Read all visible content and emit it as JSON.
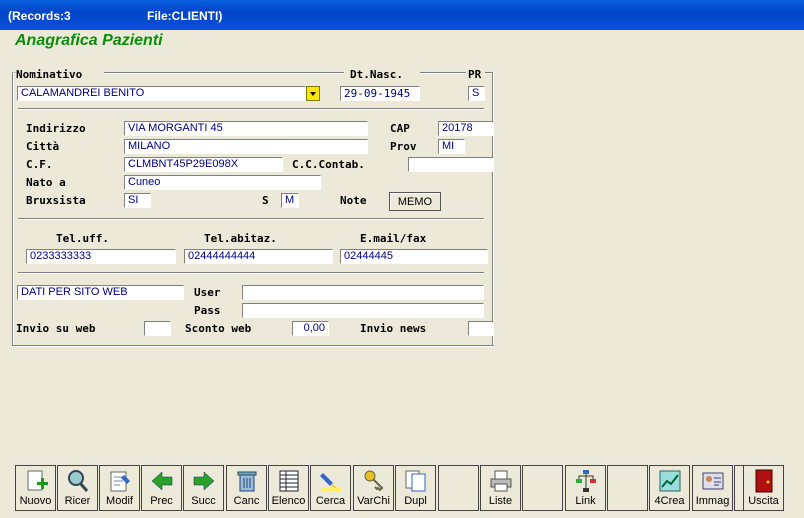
{
  "titlebar": {
    "records": "(Records:3",
    "file": "File:CLIENTI)"
  },
  "heading": "Anagrafica Pazienti",
  "labels": {
    "nominativo": "Nominativo",
    "dtnasc": "Dt.Nasc.",
    "pr": "PR",
    "indirizzo": "Indirizzo",
    "cap": "CAP",
    "citta": "Città",
    "prov": "Prov",
    "cf": "C.F.",
    "cccontab": "C.C.Contab.",
    "natoa": "Nato a",
    "bruxsista": "Bruxsista",
    "s": "S",
    "note": "Note",
    "telufficio": "Tel.uff.",
    "telabitaz": "Tel.abitaz.",
    "email": "E.mail/fax",
    "user": "User",
    "pass": "Pass",
    "inviosuweb": "Invio su web",
    "scontoweb": "Sconto web",
    "invionews": "Invio news"
  },
  "fields": {
    "nominativo": "CALAMANDREI BENITO",
    "dtnasc": "29-09-1945",
    "pr": "S",
    "indirizzo": "VIA MORGANTI 45",
    "cap": "20178",
    "citta": "MILANO",
    "prov": "MI",
    "cf": "CLMBNT45P29E098X",
    "cccontab": "",
    "natoa": "Cuneo",
    "bruxsista": "SI",
    "sesso": "M",
    "telufficio": "0233333333",
    "telabitaz": "02444444444",
    "email": "02444445",
    "datisitoweb": "DATI PER SITO WEB",
    "user": "",
    "pass": "",
    "inviosuweb": "",
    "scontoweb": "0,00",
    "invionews": ""
  },
  "memo_label": "MEMO",
  "toolbar": [
    {
      "label": "Nuovo",
      "icon": "new-document-icon"
    },
    {
      "label": "Ricer",
      "icon": "magnifier-icon"
    },
    {
      "label": "Modif",
      "icon": "edit-document-icon"
    },
    {
      "label": "Prec",
      "icon": "arrow-left-icon"
    },
    {
      "label": "Succ",
      "icon": "arrow-right-icon"
    },
    {
      "label": "Canc",
      "icon": "trash-icon"
    },
    {
      "label": "Elenco",
      "icon": "list-icon"
    },
    {
      "label": "Cerca",
      "icon": "find-highlight-icon"
    },
    {
      "label": "VarChi",
      "icon": "keys-icon"
    },
    {
      "label": "Dupl",
      "icon": "duplicate-icon"
    },
    {
      "label": "",
      "icon": ""
    },
    {
      "label": "Liste",
      "icon": "printer-icon"
    },
    {
      "label": "",
      "icon": ""
    },
    {
      "label": "Link",
      "icon": "tree-icon"
    },
    {
      "label": "",
      "icon": ""
    },
    {
      "label": "4Crea",
      "icon": "chart-icon"
    },
    {
      "label": "Immag",
      "icon": "id-card-icon"
    },
    {
      "label": "",
      "icon": ""
    },
    {
      "label": "Uscita",
      "icon": "exit-door-icon"
    }
  ]
}
